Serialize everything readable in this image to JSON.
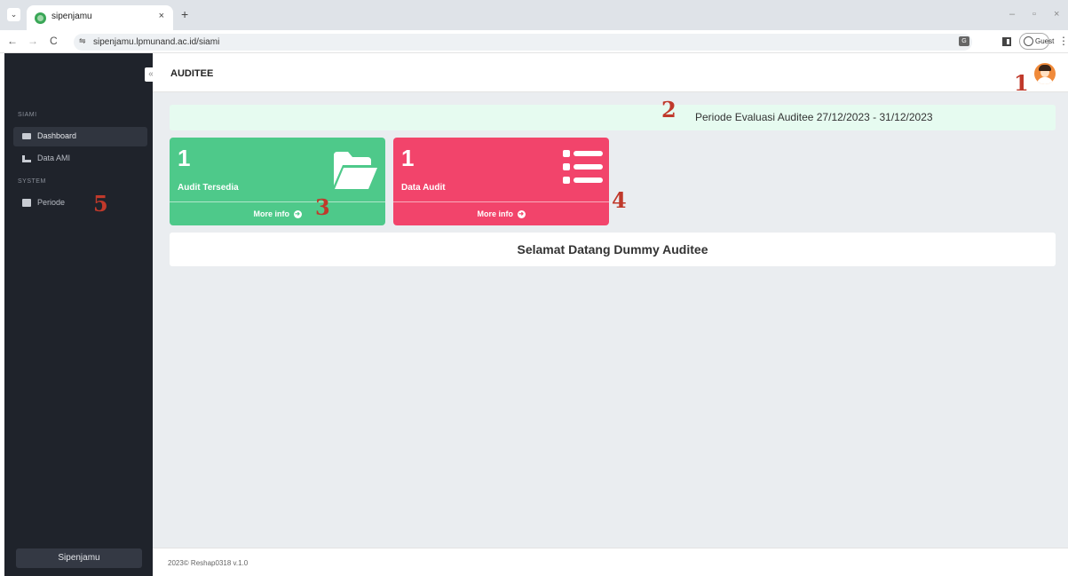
{
  "browser": {
    "tab_menu_icon": "chevron-down-icon",
    "tab_title": "sipenjamu",
    "tab_close": "×",
    "new_tab": "+",
    "url": "sipenjamu.lpmunand.ac.id/siami",
    "profile_label": "Guest",
    "window_controls": {
      "minimize": "–",
      "restore": "▫",
      "close": "×"
    },
    "nav": {
      "back": "←",
      "forward": "→",
      "reload": "C"
    }
  },
  "sidebar": {
    "toggle": "«",
    "sections": [
      {
        "title": "SIAMI",
        "items": [
          {
            "label": "Dashboard",
            "icon": "monitor-icon",
            "active": true
          },
          {
            "label": "Data AMI",
            "icon": "chart-icon",
            "active": false
          }
        ]
      },
      {
        "title": "SYSTEM",
        "items": [
          {
            "label": "Periode",
            "icon": "calendar-icon",
            "active": false
          }
        ]
      }
    ],
    "footer_button": "Sipenjamu"
  },
  "header": {
    "title": "AUDITEE"
  },
  "markers": [
    "1",
    "2",
    "3",
    "4",
    "5"
  ],
  "period": {
    "text": "Periode Evaluasi Auditee 27/12/2023 - 31/12/2023",
    "bg_color": "#e6fbf0"
  },
  "boxes": [
    {
      "number": "1",
      "label": "Audit Tersedia",
      "footer": "More info",
      "icon": "folder-open-icon",
      "color": "#4ec98a"
    },
    {
      "number": "1",
      "label": "Data Audit",
      "footer": "More info",
      "icon": "list-icon",
      "color": "#f2446b"
    }
  ],
  "welcome": "Selamat Datang Dummy Auditee",
  "footer": {
    "text": "2023© Reshap0318 v.1.0"
  },
  "colors": {
    "sidebar_bg": "#1f232b",
    "main_bg": "#eaedf0",
    "marker": "#c0392b"
  }
}
